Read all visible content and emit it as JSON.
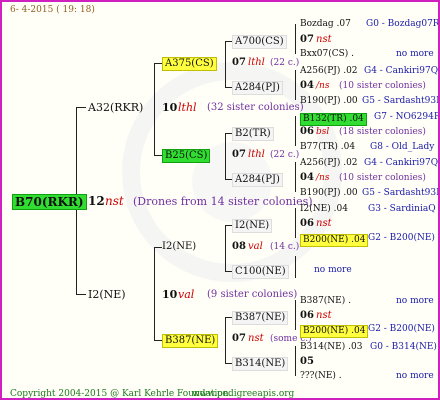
{
  "header": {
    "date": "6- 4-2015 ( 19: 18)"
  },
  "footer": {
    "copyright": "Copyright 2004-2015 @ Karl Kehrle Foundation.",
    "url": "www.pedigreeapis.org"
  },
  "root": {
    "label": "B70(RKR)",
    "gen": "12",
    "breed": "nst",
    "colonies": "(Drones from 14 sister colonies)"
  },
  "upper": {
    "label": "A32(RKR)",
    "gen": "10",
    "breed": "lthl",
    "colonies": "(32 sister colonies)"
  },
  "lower": {
    "label": "I2(NE)",
    "gen": "10",
    "breed": "val",
    "colonies": "(9 sister colonies)"
  },
  "a375": {
    "label": "A375(CS)",
    "gen": "07",
    "breed": "lthl",
    "colonies": "(22 c.)",
    "q1": "A700(CS)",
    "q2": "A284(PJ)"
  },
  "b25": {
    "label": "B25(CS)",
    "gen": "07",
    "breed": "lthl",
    "colonies": "(22 c.)",
    "q1": "B2(TR)",
    "q2": "A284(PJ)"
  },
  "i2b": {
    "label": "I2(NE)",
    "gen": "08",
    "breed": "val",
    "colonies": "(14 c.)",
    "q1": "I2(NE)",
    "q2": "C100(NE)"
  },
  "b387": {
    "label": "B387(NE)",
    "gen": "07",
    "breed": "nst",
    "colonies": "(some c.)",
    "q1": "B387(NE)",
    "q2": "B314(NE)"
  },
  "right": [
    {
      "a": "Bozdag .07",
      "b": "G0 - Bozdag07R"
    },
    {
      "a": "07",
      "b": "nst"
    },
    {
      "a": "Bxx07(CS) .",
      "b": "no more"
    },
    {
      "a": "A256(PJ) .02",
      "b": "G4 - Cankiri97Q"
    },
    {
      "a": "04",
      "b": "/ns",
      "c": "(10 sister colonies)"
    },
    {
      "a": "B190(PJ) .00",
      "b": "G5 - Sardasht93R"
    },
    {
      "a": "B132(TR) .04",
      "b": "G7 - NO6294R"
    },
    {
      "a": "06",
      "b": "bsl",
      "c": "(18 sister colonies)"
    },
    {
      "a": "B77(TR) .04",
      "b": "G8 - Old_Lady"
    },
    {
      "a": "A256(PJ) .02",
      "b": "G4 - Cankiri97Q"
    },
    {
      "a": "04",
      "b": "/ns",
      "c": "(10 sister colonies)"
    },
    {
      "a": "B190(PJ) .00",
      "b": "G5 - Sardasht93R"
    },
    {
      "a": "I2(NE) .04",
      "b": "G3 - SardiniaQ"
    },
    {
      "a": "06",
      "b": "nst"
    },
    {
      "a": "B200(NE) .04",
      "b": "G2 - B200(NE)"
    },
    {
      "a": "no more"
    },
    {
      "a": "B387(NE) .",
      "b": "no more"
    },
    {
      "a": "06",
      "b": "nst"
    },
    {
      "a": "B200(NE) .04",
      "b": "G2 - B200(NE)"
    },
    {
      "a": "B314(NE) .03",
      "b": "G0 - B314(NE)"
    },
    {
      "a": "05"
    },
    {
      "a": "???(NE) .",
      "b": "no more"
    }
  ]
}
